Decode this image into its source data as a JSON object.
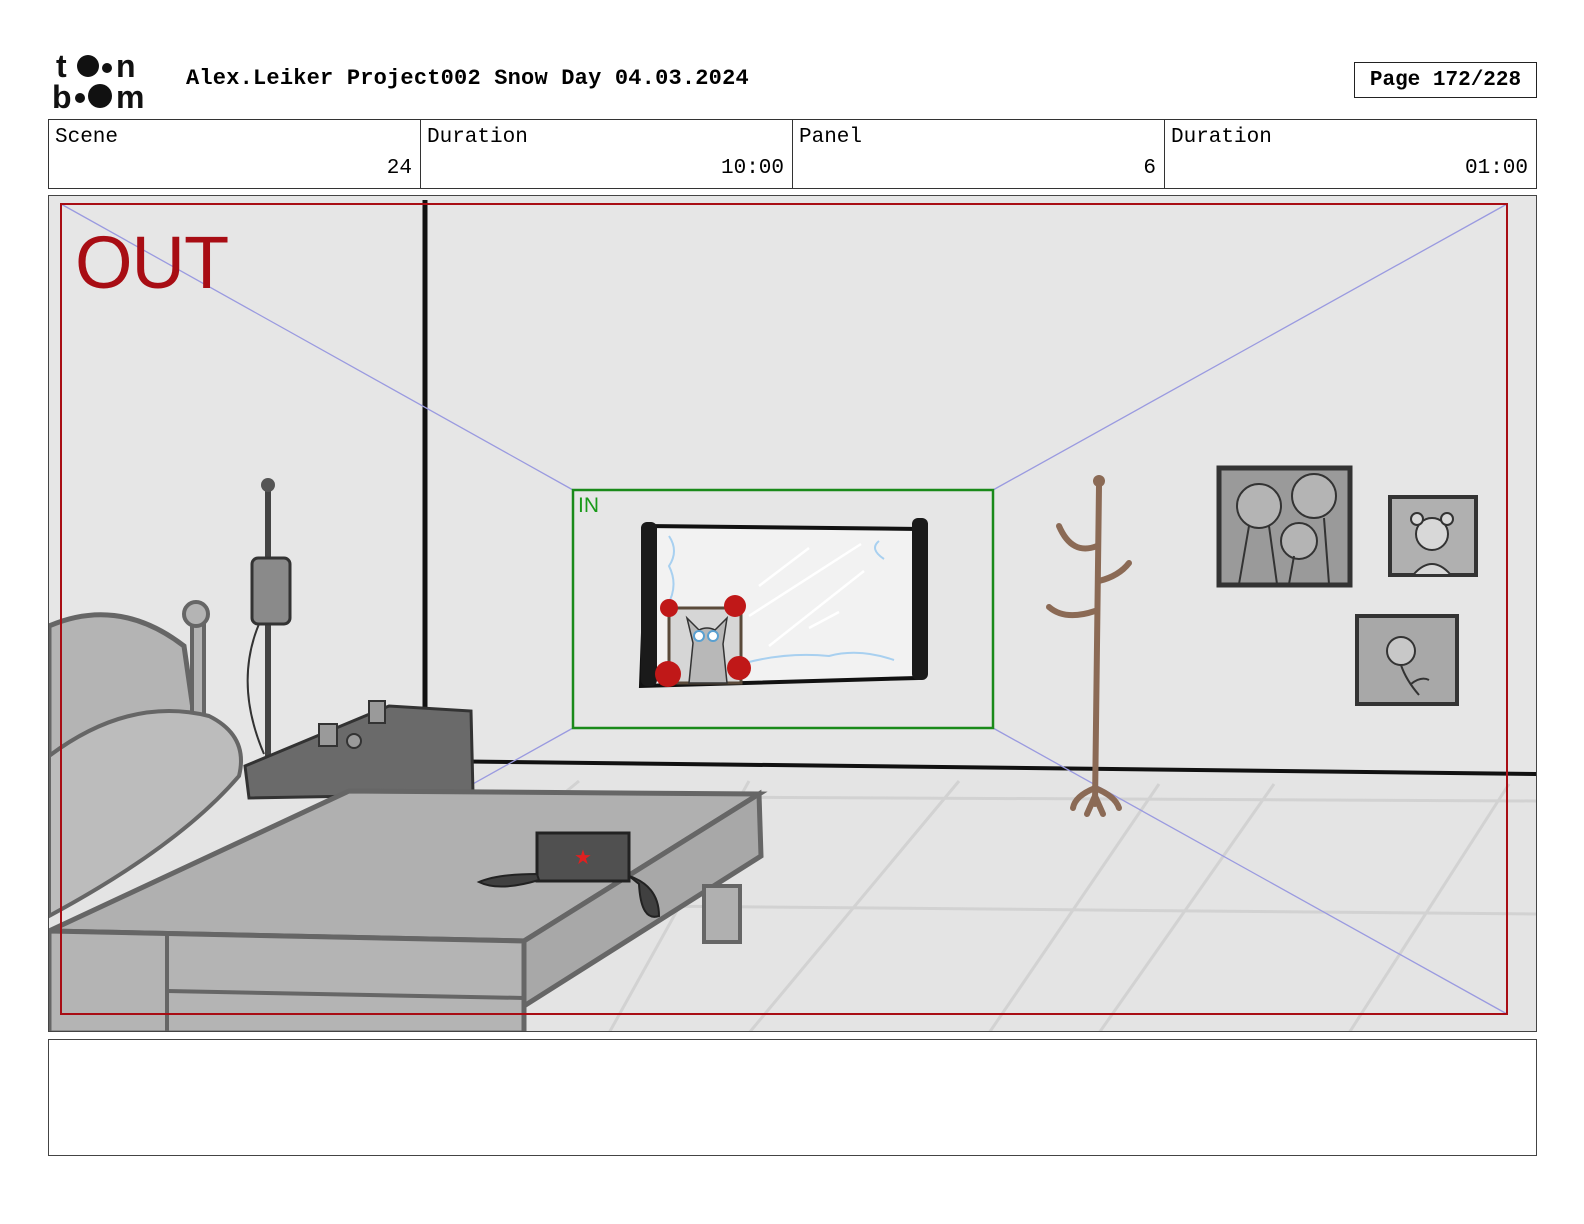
{
  "header": {
    "logo_text": "toon boom",
    "title": "Alex.Leiker Project002 Snow Day 04.03.2024",
    "page": "Page 172/228"
  },
  "info": {
    "scene_label": "Scene",
    "scene_value": "24",
    "scene_duration_label": "Duration",
    "scene_duration_value": "10:00",
    "panel_label": "Panel",
    "panel_value": "6",
    "panel_duration_label": "Duration",
    "panel_duration_value": "01:00"
  },
  "panel": {
    "out_label": "OUT",
    "in_label": "IN",
    "colors": {
      "out_frame": "#a80d14",
      "in_frame": "#1a8a1a",
      "guides": "#8c8ce0",
      "wall": "#e6e6e6",
      "bed": "#b4b4b4",
      "coat_rack": "#8b6a55",
      "roses": "#c01818",
      "curtain_lace": "#a8d0f0"
    }
  },
  "notes": {
    "text": ""
  }
}
